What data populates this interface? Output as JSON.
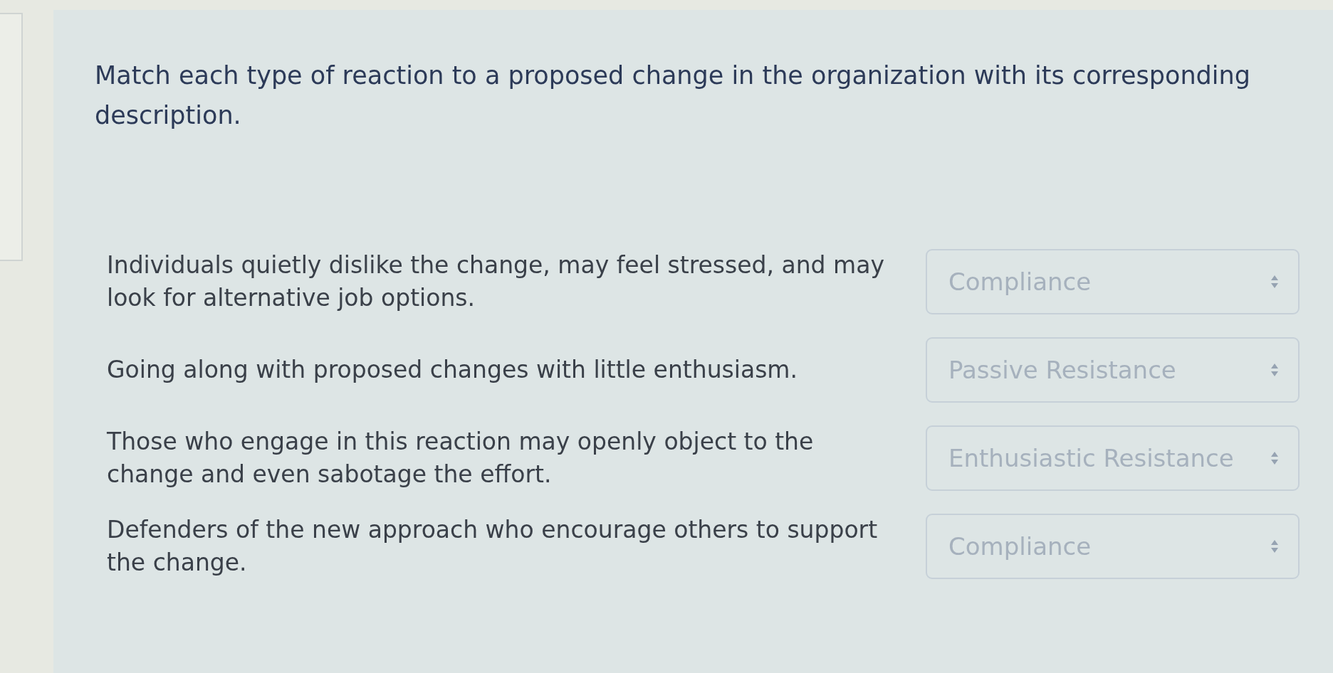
{
  "question": "Match each type of reaction to a proposed change in the organization with its corresponding description.",
  "items": [
    {
      "description": "Individuals quietly dislike the change, may feel stressed, and may look for alternative job options.",
      "select": {
        "value": "Compliance"
      }
    },
    {
      "description": "Going along with proposed changes with little enthusiasm.",
      "select": {
        "value": "Passive Resistance"
      }
    },
    {
      "description": "Those who engage in this reaction may openly object to the change and even sabotage the effort.",
      "select": {
        "value": "Enthusiastic Resistance"
      }
    },
    {
      "description": "Defenders of the new approach who encourage others to support the change.",
      "select": {
        "value": "Compliance"
      }
    }
  ]
}
